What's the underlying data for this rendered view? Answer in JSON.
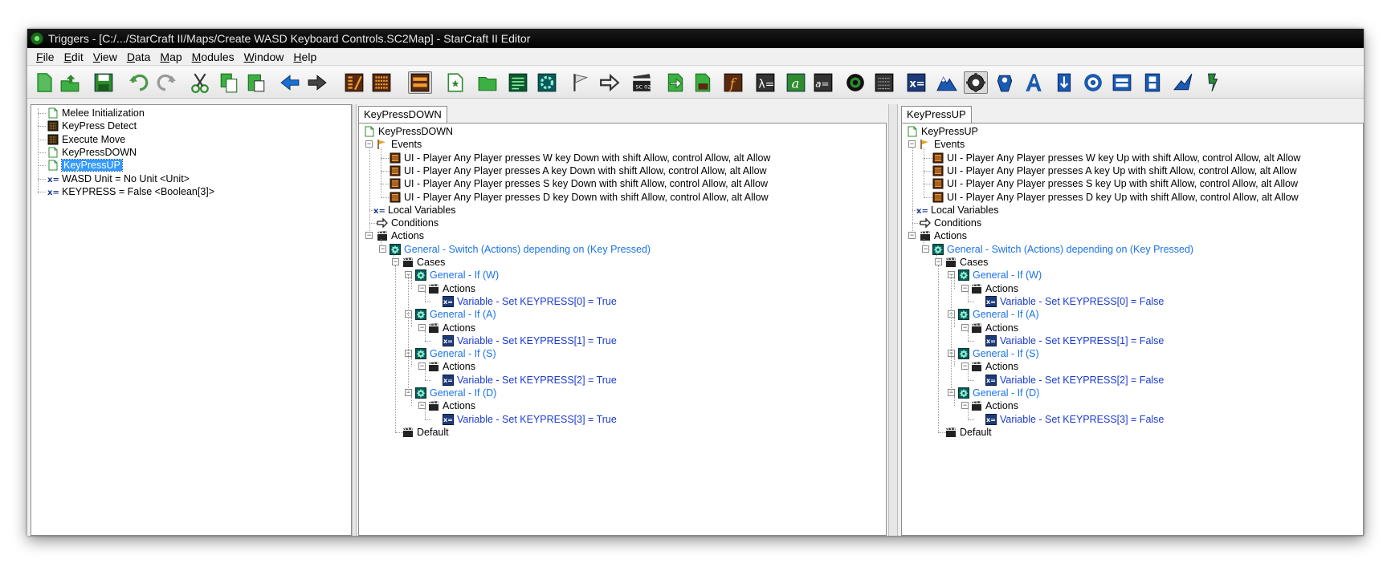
{
  "window": {
    "title": "Triggers - [C:/.../StarCraft II/Maps/Create WASD Keyboard Controls.SC2Map] - StarCraft II Editor"
  },
  "menu": [
    "File",
    "Edit",
    "View",
    "Data",
    "Map",
    "Modules",
    "Window",
    "Help"
  ],
  "toolbar_icons": [
    "new-icon",
    "open-icon",
    "save-icon",
    "undo-icon",
    "redo-icon",
    "cut-icon",
    "copy-icon",
    "paste-icon",
    "back-icon",
    "forward-icon",
    "trigger-module-icon",
    "list-icon",
    "trigger-view-icon",
    "new-trigger-icon",
    "new-folder-icon",
    "new-element-icon",
    "new-action-icon",
    "new-event-icon",
    "new-condition-icon",
    "clapper-icon",
    "enable-icon",
    "new-script-icon",
    "function-icon",
    "lambda-icon",
    "preset-icon",
    "variable-icon",
    "record-icon",
    "text-module-icon",
    "var-module-icon",
    "terrain-icon",
    "gear-module-icon",
    "unit-module-icon",
    "text-a-icon",
    "import-icon",
    "cutscene-icon",
    "ai-icon",
    "film-icon",
    "hero-icon",
    "extension-icon"
  ],
  "left_tree": [
    {
      "label": "Melee Initialization",
      "icon": "trigger-icon"
    },
    {
      "label": "KeyPress Detect",
      "icon": "event-trigger-icon"
    },
    {
      "label": "Execute Move",
      "icon": "event-trigger-icon"
    },
    {
      "label": "KeyPressDOWN",
      "icon": "trigger-icon"
    },
    {
      "label": "KeyPressUP",
      "icon": "trigger-icon",
      "selected": true
    },
    {
      "label": "WASD Unit = No Unit <Unit>",
      "icon": "variable-icon"
    },
    {
      "label": "KEYPRESS = False <Boolean[3]>",
      "icon": "variable-icon"
    }
  ],
  "panels": [
    {
      "tab": "KeyPressDOWN",
      "trigger": "KeyPressDOWN",
      "events_label": "Events",
      "events": [
        "UI - Player Any Player presses W key Down with shift Allow, control Allow, alt Allow",
        "UI - Player Any Player presses A key Down with shift Allow, control Allow, alt Allow",
        "UI - Player Any Player presses S key Down with shift Allow, control Allow, alt Allow",
        "UI - Player Any Player presses D key Down with shift Allow, control Allow, alt Allow"
      ],
      "local_vars": "Local Variables",
      "conditions": "Conditions",
      "actions": "Actions",
      "switch": "General - Switch (Actions) depending on (Key Pressed)",
      "cases": "Cases",
      "case_list": [
        {
          "if": "General - If (W)",
          "actions": "Actions",
          "set": "Variable - Set KEYPRESS[0] = True"
        },
        {
          "if": "General - If (A)",
          "actions": "Actions",
          "set": "Variable - Set KEYPRESS[1] = True"
        },
        {
          "if": "General - If (S)",
          "actions": "Actions",
          "set": "Variable - Set KEYPRESS[2] = True"
        },
        {
          "if": "General - If (D)",
          "actions": "Actions",
          "set": "Variable - Set KEYPRESS[3] = True"
        }
      ],
      "default": "Default"
    },
    {
      "tab": "KeyPressUP",
      "trigger": "KeyPressUP",
      "events_label": "Events",
      "events": [
        "UI - Player Any Player presses W key Up with shift Allow, control Allow, alt Allow",
        "UI - Player Any Player presses A key Up with shift Allow, control Allow, alt Allow",
        "UI - Player Any Player presses S key Up with shift Allow, control Allow, alt Allow",
        "UI - Player Any Player presses D key Up with shift Allow, control Allow, alt Allow"
      ],
      "local_vars": "Local Variables",
      "conditions": "Conditions",
      "actions": "Actions",
      "switch": "General - Switch (Actions) depending on (Key Pressed)",
      "cases": "Cases",
      "case_list": [
        {
          "if": "General - If (W)",
          "actions": "Actions",
          "set": "Variable - Set KEYPRESS[0] = False"
        },
        {
          "if": "General - If (A)",
          "actions": "Actions",
          "set": "Variable - Set KEYPRESS[1] = False"
        },
        {
          "if": "General - If (S)",
          "actions": "Actions",
          "set": "Variable - Set KEYPRESS[2] = False"
        },
        {
          "if": "General - If (D)",
          "actions": "Actions",
          "set": "Variable - Set KEYPRESS[3] = False"
        }
      ],
      "default": "Default"
    }
  ],
  "colors": {
    "link": "#1a73e8",
    "selection": "#3399ff",
    "titlebar": "#000000"
  }
}
